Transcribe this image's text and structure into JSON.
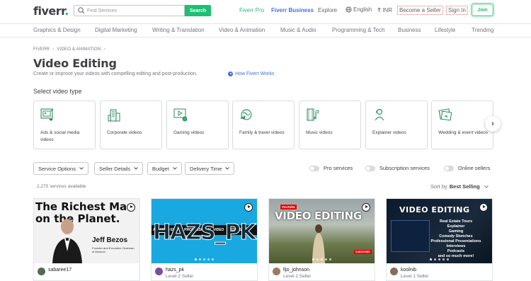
{
  "header": {
    "logo": "fiverr",
    "logo_dot": ".",
    "search_placeholder": "Find Services",
    "search_button": "Search",
    "fiverr_pro": "Fiverr Pro",
    "fiverr_business": "Fiverr Business",
    "explore": "Explore",
    "language": "English",
    "currency": "₹ INR",
    "become_seller": "Become a Seller",
    "sign_in": "Sign In",
    "join": "Join"
  },
  "categories": [
    "Graphics & Design",
    "Digital Marketing",
    "Writing & Translation",
    "Video & Animation",
    "Music & Audio",
    "Programming & Tech",
    "Business",
    "Lifestyle",
    "Trending"
  ],
  "breadcrumb": {
    "home": "FIVERR",
    "section": "VIDEO & ANIMATION"
  },
  "page": {
    "title": "Video Editing",
    "subtitle": "Create or improve your videos with compelling editing and post-production.",
    "how_link": "How Fiverr Works",
    "section_label": "Select video type"
  },
  "video_types": [
    {
      "label": "Ads & social media videos",
      "icon": "social-media-icon"
    },
    {
      "label": "Corporate videos",
      "icon": "building-icon"
    },
    {
      "label": "Gaming videos",
      "icon": "gaming-icon"
    },
    {
      "label": "Family & travel videos",
      "icon": "globe-travel-icon"
    },
    {
      "label": "Music videos",
      "icon": "music-film-icon"
    },
    {
      "label": "Explainer videos",
      "icon": "presenter-icon"
    },
    {
      "label": "Wedding & event videos",
      "icon": "wedding-photo-icon"
    }
  ],
  "filters": {
    "service_options": "Service Options",
    "seller_details": "Seller Details",
    "budget": "Budget",
    "delivery_time": "Delivery Time",
    "pro_services": "Pro services",
    "subscription_services": "Subscription services",
    "online_sellers": "Online sellers"
  },
  "results": {
    "count": "2,275 services available",
    "sort_label": "Sort by",
    "sort_value": "Best Selling"
  },
  "gigs": [
    {
      "seller": "sabaree17",
      "level": "",
      "thumb_line1": "The Richest Man",
      "thumb_line2": "on the Planet.",
      "thumb_name": "Jeff Bezos",
      "thumb_caption": "Founder and Executive Chairman of Amazon"
    },
    {
      "seller": "hazs_pk",
      "level": "Level 2 Seller",
      "thumb_strip_left": "AL VIDEO EDITO",
      "thumb_strip_mid": "PROFESSIONAL VIDEO",
      "thumb_strip_right": "PROFES",
      "thumb_big": "HAZS_PK"
    },
    {
      "seller": "lljo_johnson",
      "level": "Level 2 Seller",
      "thumb_logo": "YouTube",
      "thumb_title": "VIDEO EDITING",
      "thumb_badge": "SUBSCRIBE"
    },
    {
      "seller": "koolnib",
      "level": "Level 1 Seller",
      "thumb_title": "VIDEO EDITING",
      "thumb_list": [
        "Real Estate Tours",
        "Explainer",
        "Gaming",
        "Comedy Sketches",
        "Professional Presentations",
        "Interviews",
        "Podcasts",
        "and so much more!"
      ]
    }
  ]
}
